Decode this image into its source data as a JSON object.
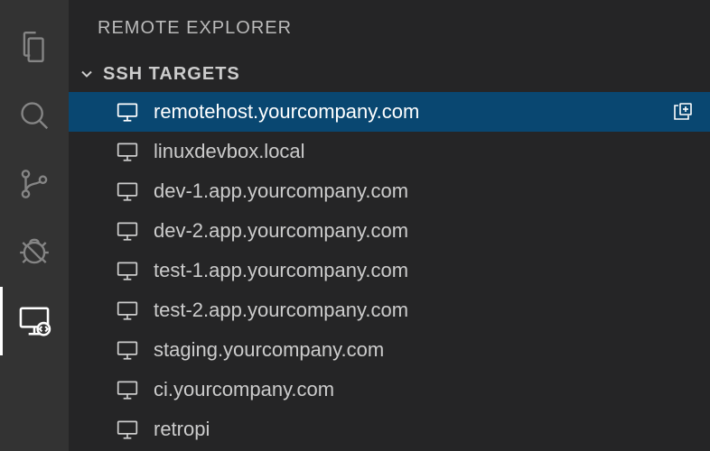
{
  "sidebar": {
    "title": "REMOTE EXPLORER",
    "section": {
      "label": "SSH TARGETS",
      "expanded": true
    },
    "hosts": [
      {
        "label": "remotehost.yourcompany.com",
        "selected": true
      },
      {
        "label": "linuxdevbox.local",
        "selected": false
      },
      {
        "label": "dev-1.app.yourcompany.com",
        "selected": false
      },
      {
        "label": "dev-2.app.yourcompany.com",
        "selected": false
      },
      {
        "label": "test-1.app.yourcompany.com",
        "selected": false
      },
      {
        "label": "test-2.app.yourcompany.com",
        "selected": false
      },
      {
        "label": "staging.yourcompany.com",
        "selected": false
      },
      {
        "label": "ci.yourcompany.com",
        "selected": false
      },
      {
        "label": "retropi",
        "selected": false
      }
    ]
  },
  "activityBar": {
    "items": [
      {
        "name": "explorer",
        "active": false
      },
      {
        "name": "search",
        "active": false
      },
      {
        "name": "source-control",
        "active": false
      },
      {
        "name": "debug",
        "active": false
      },
      {
        "name": "remote-explorer",
        "active": true
      }
    ]
  },
  "colors": {
    "activityBarBg": "#333333",
    "sidebarBg": "#252526",
    "selection": "#094771",
    "fg": "#cccccc"
  }
}
